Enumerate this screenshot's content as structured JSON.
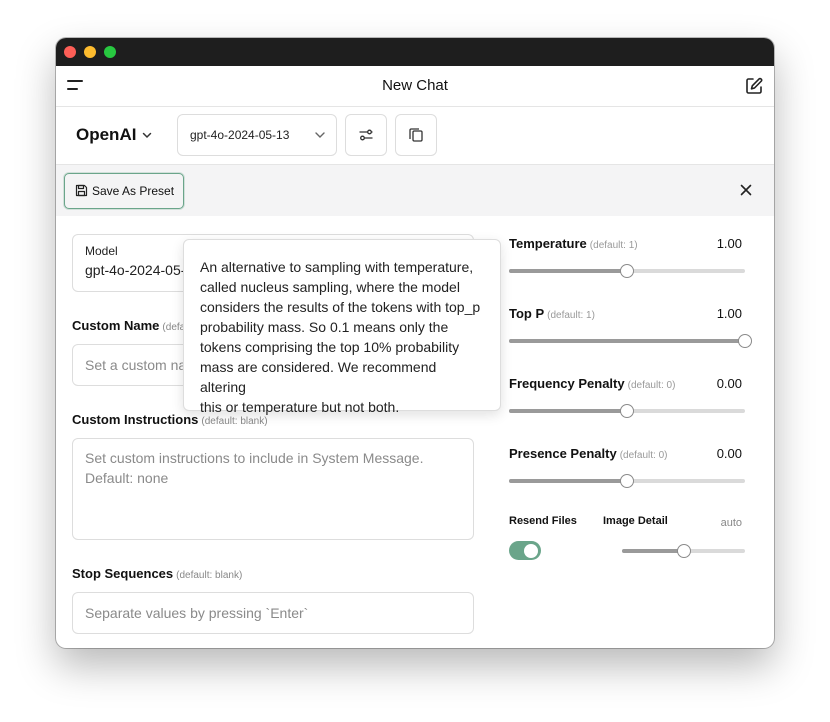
{
  "window": {
    "controls": [
      "close",
      "minimize",
      "zoom"
    ]
  },
  "header": {
    "title": "New Chat",
    "menu_icon": "menu-icon",
    "new_chat_icon": "edit-icon"
  },
  "toolbar": {
    "provider": "OpenAI",
    "model": "gpt-4o-2024-05-13",
    "settings_icon": "sliders-icon",
    "copy_icon": "copy-icon"
  },
  "preset_bar": {
    "save_label": "Save As Preset",
    "close_icon": "close-icon"
  },
  "form": {
    "model": {
      "label": "Model",
      "value": "gpt-4o-2024-05-13"
    },
    "custom_name": {
      "label": "Custom Name",
      "default": "(default: blank)",
      "placeholder": "Set a custom name"
    },
    "custom_instructions": {
      "label": "Custom Instructions",
      "default": "(default: blank)",
      "placeholder_line1": "Set custom instructions to include in System Message.",
      "placeholder_line2": "Default: none"
    },
    "stop_sequences": {
      "label": "Stop Sequences",
      "default": "(default: blank)",
      "placeholder": "Separate values by pressing `Enter`"
    }
  },
  "params": {
    "temperature": {
      "label": "Temperature",
      "default": "(default: 1)",
      "value": "1.00",
      "fraction": 0.5
    },
    "top_p": {
      "label": "Top P",
      "default": "(default: 1)",
      "value": "1.00",
      "fraction": 1.0
    },
    "frequency_penalty": {
      "label": "Frequency Penalty",
      "default": "(default: 0)",
      "value": "0.00",
      "fraction": 0.5
    },
    "presence_penalty": {
      "label": "Presence Penalty",
      "default": "(default: 0)",
      "value": "0.00",
      "fraction": 0.5
    },
    "resend_files": {
      "label": "Resend Files",
      "on": true
    },
    "image_detail": {
      "label": "Image Detail",
      "value": "auto",
      "fraction": 0.5
    }
  },
  "tooltip": {
    "lines": [
      "An alternative to sampling with temperature,",
      "called nucleus sampling, where the model",
      "considers the results of the tokens with top_p",
      "probability mass. So 0.1 means only the",
      "tokens comprising the top 10% probability",
      "mass are considered. We recommend altering",
      "this or temperature but not both."
    ]
  },
  "colors": {
    "accent": "#6aa58a",
    "titlebar": "#1e1e1e",
    "panel": "#f4f4f5"
  }
}
